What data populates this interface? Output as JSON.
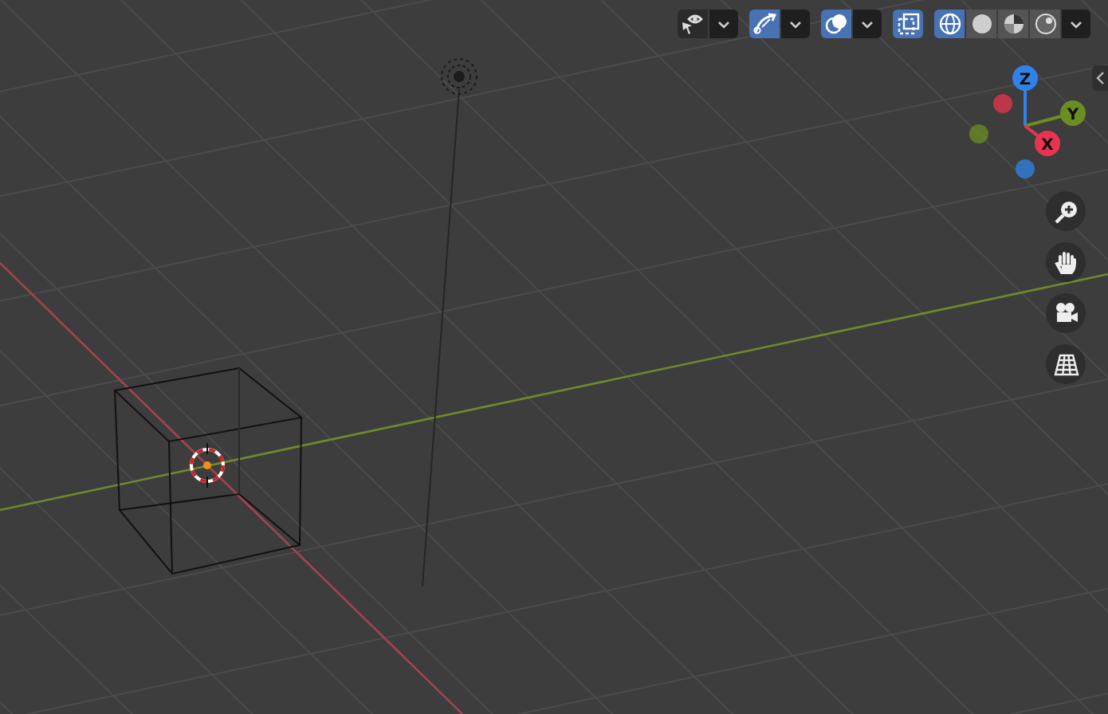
{
  "header": {
    "tools": [
      {
        "kind": "visibility",
        "on": false
      },
      {
        "kind": "gizmo",
        "on": true
      },
      {
        "kind": "overlay",
        "on": true
      },
      {
        "kind": "xray",
        "on": true
      }
    ],
    "shading_modes": [
      {
        "kind": "wireframe",
        "selected": true
      },
      {
        "kind": "solid",
        "selected": false
      },
      {
        "kind": "material",
        "selected": false
      },
      {
        "kind": "rendered",
        "selected": false
      }
    ]
  },
  "navigation_gizmo": {
    "axes": [
      {
        "label": "Z",
        "color": "#2f83e8"
      },
      {
        "label": "Y",
        "color": "#6b8e23"
      },
      {
        "label": "X",
        "color": "#e8344f"
      }
    ]
  }
}
